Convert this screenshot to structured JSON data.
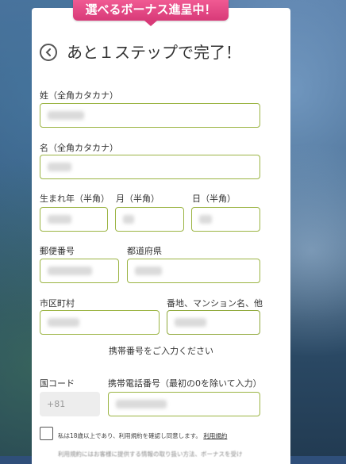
{
  "ribbon": {
    "text": "選べるボーナス進呈中！"
  },
  "header": {
    "title": "あと１ステップで完了！"
  },
  "form": {
    "last_name_kana": {
      "label": "姓（全角カタカナ）",
      "value": ""
    },
    "first_name_kana": {
      "label": "名（全角カタカナ）",
      "value": ""
    },
    "birth_year": {
      "label": "生まれ年（半角）",
      "value": ""
    },
    "birth_month": {
      "label": "月（半角）",
      "value": ""
    },
    "birth_day": {
      "label": "日（半角）",
      "value": ""
    },
    "postal_code": {
      "label": "郵便番号",
      "value": ""
    },
    "prefecture": {
      "label": "都道府県",
      "value": ""
    },
    "city": {
      "label": "市区町村",
      "value": ""
    },
    "address": {
      "label": "番地、マンション名、他",
      "value": ""
    },
    "phone_prompt": "携帯番号をご入力ください",
    "country_code": {
      "label": "国コード",
      "placeholder": "+81"
    },
    "phone": {
      "label": "携帯電話番号（最初の0を除いて入力）",
      "value": ""
    }
  },
  "agreement": {
    "text": "私は18歳以上であり、利用規約を確認し同意します。",
    "link": "利用規約",
    "cut_line": "利用規約にはお客様に提供する情報の取り扱い方法、ボーナスを受け"
  },
  "colors": {
    "accent_border": "#9bb443",
    "ribbon": "#e24a86"
  }
}
